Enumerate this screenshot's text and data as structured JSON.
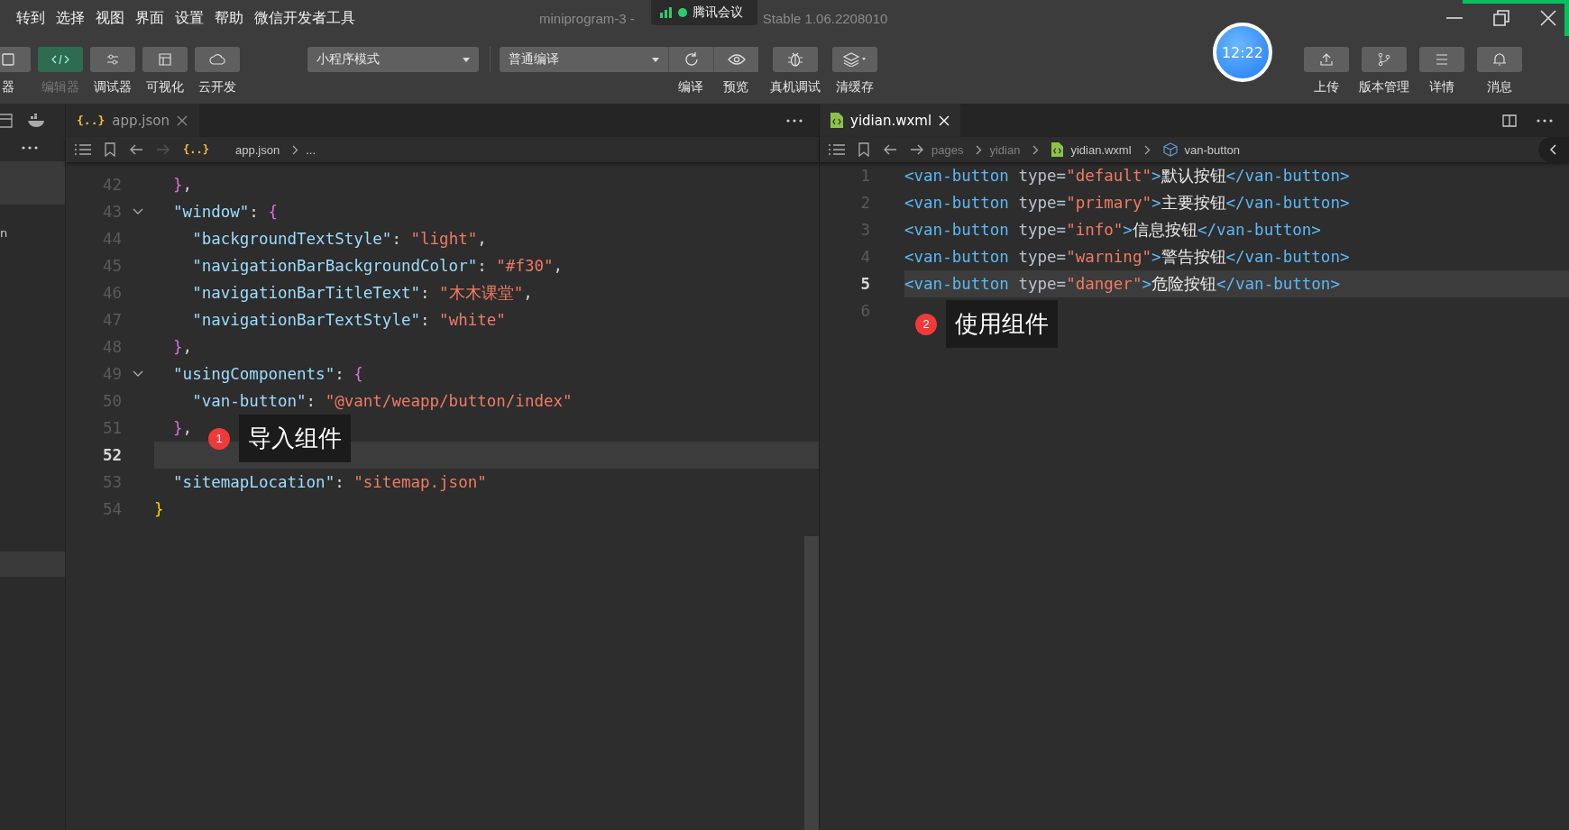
{
  "menu": [
    "转到",
    "选择",
    "视图",
    "界面",
    "设置",
    "帮助",
    "微信开发者工具"
  ],
  "title": {
    "name": "miniprogram-3 -",
    "version": "Stable 1.06.2208010"
  },
  "meeting_overlay": {
    "label": "腾讯会议"
  },
  "toolbar_left": [
    {
      "label": "器",
      "selected": false
    },
    {
      "label": "编辑器",
      "selected": true
    },
    {
      "label": "调试器",
      "selected": false
    },
    {
      "label": "可视化",
      "selected": false
    },
    {
      "label": "云开发",
      "selected": false
    }
  ],
  "mode_dropdown": {
    "value": "小程序模式"
  },
  "compile_dropdown": {
    "value": "普通编译"
  },
  "compile_actions": [
    {
      "label": "编译"
    },
    {
      "label": "预览"
    }
  ],
  "debug_actions": [
    {
      "label": "真机调试"
    },
    {
      "label": "清缓存"
    }
  ],
  "clock": {
    "time": "12:22"
  },
  "toolbar_right": [
    {
      "label": "上传"
    },
    {
      "label": "版本管理"
    },
    {
      "label": "详情"
    },
    {
      "label": "消息"
    }
  ],
  "side_panel": {
    "fragment": "n"
  },
  "editors": [
    {
      "tab": {
        "glyph": "{..}",
        "label": "app.json",
        "selected": false
      },
      "breadcrumb": {
        "glyph": "{..}",
        "items": [
          "app.json",
          "..."
        ]
      },
      "lines": [
        {
          "number": "42",
          "current": false,
          "foldable": false,
          "tokens": [
            {
              "text": "  }",
              "kind": "brace2"
            },
            {
              "text": ",",
              "kind": "punct"
            }
          ]
        },
        {
          "number": "43",
          "current": false,
          "foldable": true,
          "tokens": [
            {
              "text": "  \"window\"",
              "kind": "key"
            },
            {
              "text": ": ",
              "kind": "punct"
            },
            {
              "text": "{",
              "kind": "brace2"
            }
          ]
        },
        {
          "number": "44",
          "current": false,
          "foldable": false,
          "tokens": [
            {
              "text": "    \"backgroundTextStyle\"",
              "kind": "key"
            },
            {
              "text": ": ",
              "kind": "punct"
            },
            {
              "text": "\"light\"",
              "kind": "string"
            },
            {
              "text": ",",
              "kind": "punct"
            }
          ]
        },
        {
          "number": "45",
          "current": false,
          "foldable": false,
          "tokens": [
            {
              "text": "    \"navigationBarBackgroundColor\"",
              "kind": "key"
            },
            {
              "text": ": ",
              "kind": "punct"
            },
            {
              "text": "\"#f30\"",
              "kind": "string"
            },
            {
              "text": ",",
              "kind": "punct"
            }
          ]
        },
        {
          "number": "46",
          "current": false,
          "foldable": false,
          "tokens": [
            {
              "text": "    \"navigationBarTitleText\"",
              "kind": "key"
            },
            {
              "text": ": ",
              "kind": "punct"
            },
            {
              "text": "\"木木课堂\"",
              "kind": "string"
            },
            {
              "text": ",",
              "kind": "punct"
            }
          ]
        },
        {
          "number": "47",
          "current": false,
          "foldable": false,
          "tokens": [
            {
              "text": "    \"navigationBarTextStyle\"",
              "kind": "key"
            },
            {
              "text": ": ",
              "kind": "punct"
            },
            {
              "text": "\"white\"",
              "kind": "string"
            }
          ]
        },
        {
          "number": "48",
          "current": false,
          "foldable": false,
          "tokens": [
            {
              "text": "  }",
              "kind": "brace2"
            },
            {
              "text": ",",
              "kind": "punct"
            }
          ]
        },
        {
          "number": "49",
          "current": false,
          "foldable": true,
          "tokens": [
            {
              "text": "  \"usingComponents\"",
              "kind": "key"
            },
            {
              "text": ": ",
              "kind": "punct"
            },
            {
              "text": "{",
              "kind": "brace2"
            }
          ]
        },
        {
          "number": "50",
          "current": false,
          "foldable": false,
          "tokens": [
            {
              "text": "    \"van-button\"",
              "kind": "key"
            },
            {
              "text": ": ",
              "kind": "punct"
            },
            {
              "text": "\"@vant/weapp/button/index\"",
              "kind": "string"
            }
          ]
        },
        {
          "number": "51",
          "current": false,
          "foldable": false,
          "tokens": [
            {
              "text": "  }",
              "kind": "brace2"
            },
            {
              "text": ",",
              "kind": "punct"
            }
          ]
        },
        {
          "number": "52",
          "current": true,
          "foldable": false
        },
        {
          "number": "53",
          "current": false,
          "foldable": false,
          "tokens": [
            {
              "text": "  \"sitemapLocation\"",
              "kind": "key"
            },
            {
              "text": ": ",
              "kind": "punct"
            },
            {
              "text": "\"sitemap.json\"",
              "kind": "string"
            }
          ]
        },
        {
          "number": "54",
          "current": false,
          "foldable": false,
          "tokens": [
            {
              "text": "}",
              "kind": "brace1"
            }
          ]
        }
      ],
      "callout": {
        "badge": "1",
        "text": "导入组件"
      }
    },
    {
      "tab": {
        "label": "yidian.wxml",
        "selected": true
      },
      "breadcrumb": {
        "items": [
          "pages",
          "yidian",
          "yidian.wxml",
          "van-button"
        ]
      },
      "lines": [
        {
          "number": "1",
          "current": false,
          "foldable": false,
          "tokens": [
            {
              "text": "<van-button",
              "kind": "tag"
            },
            {
              "text": " type=",
              "kind": "attr"
            },
            {
              "text": "\"default\"",
              "kind": "string"
            },
            {
              "text": ">",
              "kind": "tag"
            },
            {
              "text": "默认按钮",
              "kind": "text"
            },
            {
              "text": "</van-button>",
              "kind": "tag"
            }
          ]
        },
        {
          "number": "2",
          "current": false,
          "foldable": false,
          "tokens": [
            {
              "text": "<van-button",
              "kind": "tag"
            },
            {
              "text": " type=",
              "kind": "attr"
            },
            {
              "text": "\"primary\"",
              "kind": "string"
            },
            {
              "text": ">",
              "kind": "tag"
            },
            {
              "text": "主要按钮",
              "kind": "text"
            },
            {
              "text": "</van-button>",
              "kind": "tag"
            }
          ]
        },
        {
          "number": "3",
          "current": false,
          "foldable": false,
          "tokens": [
            {
              "text": "<van-button",
              "kind": "tag"
            },
            {
              "text": " type=",
              "kind": "attr"
            },
            {
              "text": "\"info\"",
              "kind": "string"
            },
            {
              "text": ">",
              "kind": "tag"
            },
            {
              "text": "信息按钮",
              "kind": "text"
            },
            {
              "text": "</van-button>",
              "kind": "tag"
            }
          ]
        },
        {
          "number": "4",
          "current": false,
          "foldable": false,
          "tokens": [
            {
              "text": "<van-button",
              "kind": "tag"
            },
            {
              "text": " type=",
              "kind": "attr"
            },
            {
              "text": "\"warning\"",
              "kind": "string"
            },
            {
              "text": ">",
              "kind": "tag"
            },
            {
              "text": "警告按钮",
              "kind": "text"
            },
            {
              "text": "</van-button>",
              "kind": "tag"
            }
          ]
        },
        {
          "number": "5",
          "current": true,
          "foldable": false,
          "tokens": [
            {
              "text": "<van-button",
              "kind": "tag"
            },
            {
              "text": " type=",
              "kind": "attr"
            },
            {
              "text": "\"danger\"",
              "kind": "string"
            },
            {
              "text": ">",
              "kind": "tag"
            },
            {
              "text": "危险按钮",
              "kind": "text"
            },
            {
              "text": "</van-button>",
              "kind": "tag"
            }
          ]
        },
        {
          "number": "6",
          "current": false,
          "foldable": false
        }
      ],
      "callout": {
        "badge": "2",
        "text": "使用组件"
      }
    }
  ]
}
